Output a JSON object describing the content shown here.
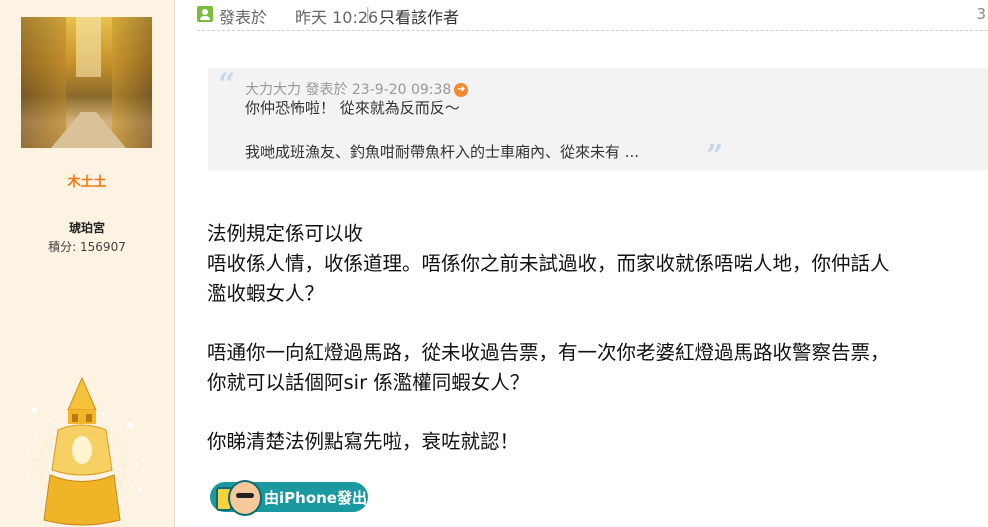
{
  "author": {
    "username": "木土土",
    "group": "琥珀宮",
    "points_label": "積分:",
    "points_value": "156907"
  },
  "post_header": {
    "posted_label": "發表於",
    "posted_time": "昨天 10:26",
    "separator": "|",
    "only_author_link": "只看該作者",
    "floor_number": "3"
  },
  "quote": {
    "meta": "大力大力 發表於 23-9-20 09:38",
    "line1": "你仲恐怖啦！ 從來就為反而反～",
    "line2": "我哋成班漁友、釣魚咁耐帶魚杆入的士車廂內、從來未有 ...",
    "open_mark": "“",
    "close_mark": "”"
  },
  "body": {
    "p1": "法例規定係可以收",
    "p2": "唔收係人情，收係道理。唔係你之前未試過收，而家收就係唔啱人地，你仲話人",
    "p3": "濫收蝦女人？",
    "p4": "唔通你一向紅燈過馬路，從未收過告票，有一次你老婆紅燈過馬路收警察告票，",
    "p5": "你就可以話個阿sir 係濫權同蝦女人？",
    "p6": "你睇清楚法例點寫先啦，衰咗就認！"
  },
  "device_badge": {
    "text": "由iPhone發出"
  },
  "colors": {
    "sidebar_bg": "#fdf3e3",
    "username": "#f07a0e",
    "quote_bg": "#f3f3f3",
    "badge_bg": "#1a9aa0"
  }
}
